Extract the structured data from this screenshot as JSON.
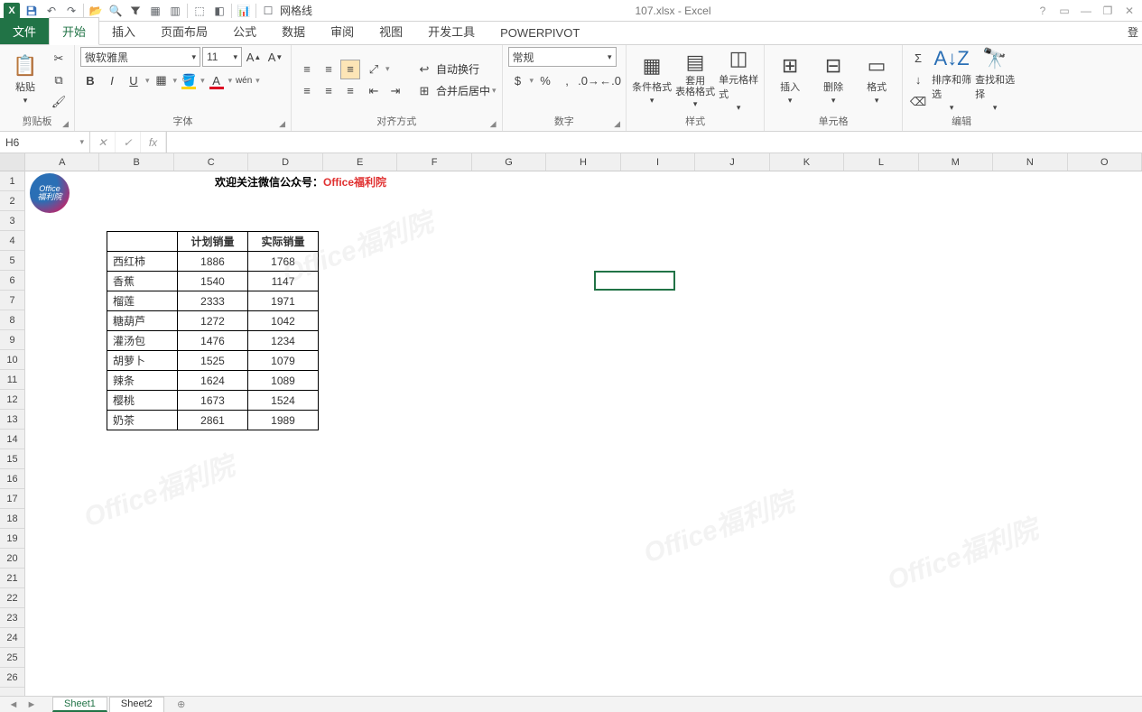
{
  "qat": {
    "title": "107.xlsx - Excel",
    "gridlines_label": "网格线"
  },
  "tabs": {
    "items": [
      "文件",
      "开始",
      "插入",
      "页面布局",
      "公式",
      "数据",
      "审阅",
      "视图",
      "开发工具",
      "POWERPIVOT"
    ],
    "active_index": 1,
    "login": "登"
  },
  "ribbon": {
    "clipboard": {
      "label": "剪贴板",
      "paste": "粘贴"
    },
    "font": {
      "label": "字体",
      "name": "微软雅黑",
      "size": "11"
    },
    "align": {
      "label": "对齐方式",
      "wrap": "自动换行",
      "merge": "合并后居中"
    },
    "number": {
      "label": "数字",
      "format": "常规"
    },
    "styles": {
      "label": "样式",
      "cond": "条件格式",
      "table": "套用\n表格格式",
      "cell": "单元格样式"
    },
    "cells": {
      "label": "单元格",
      "insert": "插入",
      "delete": "删除",
      "format": "格式"
    },
    "editing": {
      "label": "编辑",
      "sort": "排序和筛选",
      "find": "查找和选择"
    }
  },
  "formula": {
    "name_box": "H6",
    "formula": ""
  },
  "columns": [
    "A",
    "B",
    "C",
    "D",
    "E",
    "F",
    "G",
    "H",
    "I",
    "J",
    "K",
    "L",
    "M",
    "N",
    "O"
  ],
  "rows": [
    "1",
    "2",
    "3",
    "4",
    "5",
    "6",
    "7",
    "8",
    "9",
    "10",
    "11",
    "12",
    "13",
    "14",
    "15",
    "16",
    "17",
    "18",
    "19",
    "20",
    "21",
    "22",
    "23",
    "24",
    "25",
    "26"
  ],
  "banner": {
    "black": "欢迎关注微信公众号：",
    "red": "Office福利院"
  },
  "logo": {
    "line1": "Office",
    "line2": "福利院"
  },
  "table": {
    "headers": [
      "",
      "计划销量",
      "实际销量"
    ],
    "rows": [
      [
        "西红柿",
        "1886",
        "1768"
      ],
      [
        "香蕉",
        "1540",
        "1147"
      ],
      [
        "榴莲",
        "2333",
        "1971"
      ],
      [
        "糖葫芦",
        "1272",
        "1042"
      ],
      [
        "灌汤包",
        "1476",
        "1234"
      ],
      [
        "胡萝卜",
        "1525",
        "1079"
      ],
      [
        "辣条",
        "1624",
        "1089"
      ],
      [
        "樱桃",
        "1673",
        "1524"
      ],
      [
        "奶茶",
        "2861",
        "1989"
      ]
    ]
  },
  "sheets": {
    "items": [
      "Sheet1",
      "Sheet2"
    ],
    "active_index": 0
  },
  "selection": {
    "col_index": 7,
    "row_index": 5
  },
  "watermark": "Office福利院"
}
